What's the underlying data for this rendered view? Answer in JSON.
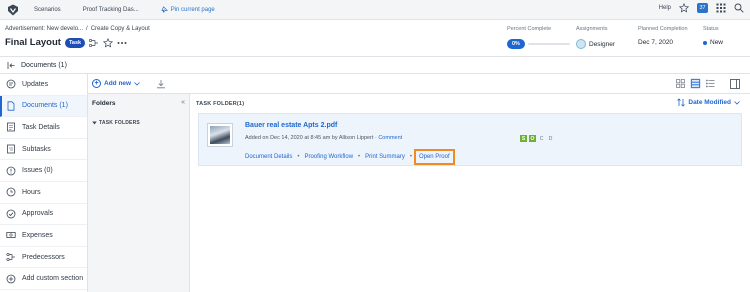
{
  "topnav": {
    "tabs": [
      "Scenarios",
      "Proof Tracking Das..."
    ],
    "pin_label": "Pin current page",
    "help_label": "Help",
    "notifications_count": "37"
  },
  "header": {
    "breadcrumb_parent": "Advertisement: New develo...",
    "breadcrumb_current": "Create Copy & Layout",
    "title": "Final Layout",
    "type_badge": "Task",
    "percent_complete_label": "Percent Complete",
    "percent_complete_value": "0%",
    "assignments_label": "Assignments",
    "assignments_value": "Designer",
    "planned_completion_label": "Planned Completion",
    "planned_completion_value": "Dec 7, 2020",
    "status_label": "Status",
    "status_value": "New"
  },
  "docbar": {
    "title": "Documents (1)"
  },
  "leftnav": {
    "items": [
      {
        "label": "Updates",
        "icon": "chat-icon"
      },
      {
        "label": "Documents (1)",
        "icon": "document-icon"
      },
      {
        "label": "Task Details",
        "icon": "details-icon"
      },
      {
        "label": "Subtasks",
        "icon": "subtasks-icon"
      },
      {
        "label": "Issues (0)",
        "icon": "issues-icon"
      },
      {
        "label": "Hours",
        "icon": "clock-icon"
      },
      {
        "label": "Approvals",
        "icon": "check-circle-icon"
      },
      {
        "label": "Expenses",
        "icon": "money-icon"
      },
      {
        "label": "Predecessors",
        "icon": "predecessors-icon"
      },
      {
        "label": "Add custom section",
        "icon": "plus-circle-icon"
      }
    ]
  },
  "toolbar": {
    "add_new_label": "Add new"
  },
  "folders": {
    "heading": "Folders",
    "task_folders_label": "TASK FOLDERS"
  },
  "main": {
    "task_folders_heading": "TASK FOLDER(1)",
    "sort_label": "Date Modified",
    "document": {
      "name": "Bauer real estate Apts 2.pdf",
      "meta": "Added on Dec 14, 2020 at 8:45 am by Allison Lippert",
      "meta_sep": "·",
      "comment_label": "Comment",
      "actions": [
        "Document Details",
        "Proofing Workflow",
        "Print Summary",
        "Open Proof"
      ],
      "badges": [
        "S",
        "O",
        "C",
        "D"
      ]
    }
  },
  "colors": {
    "accent": "#1e66d0",
    "badge_blue": "#1e4eb5",
    "highlight": "#f08a24",
    "proof_green": "#6fb035"
  }
}
